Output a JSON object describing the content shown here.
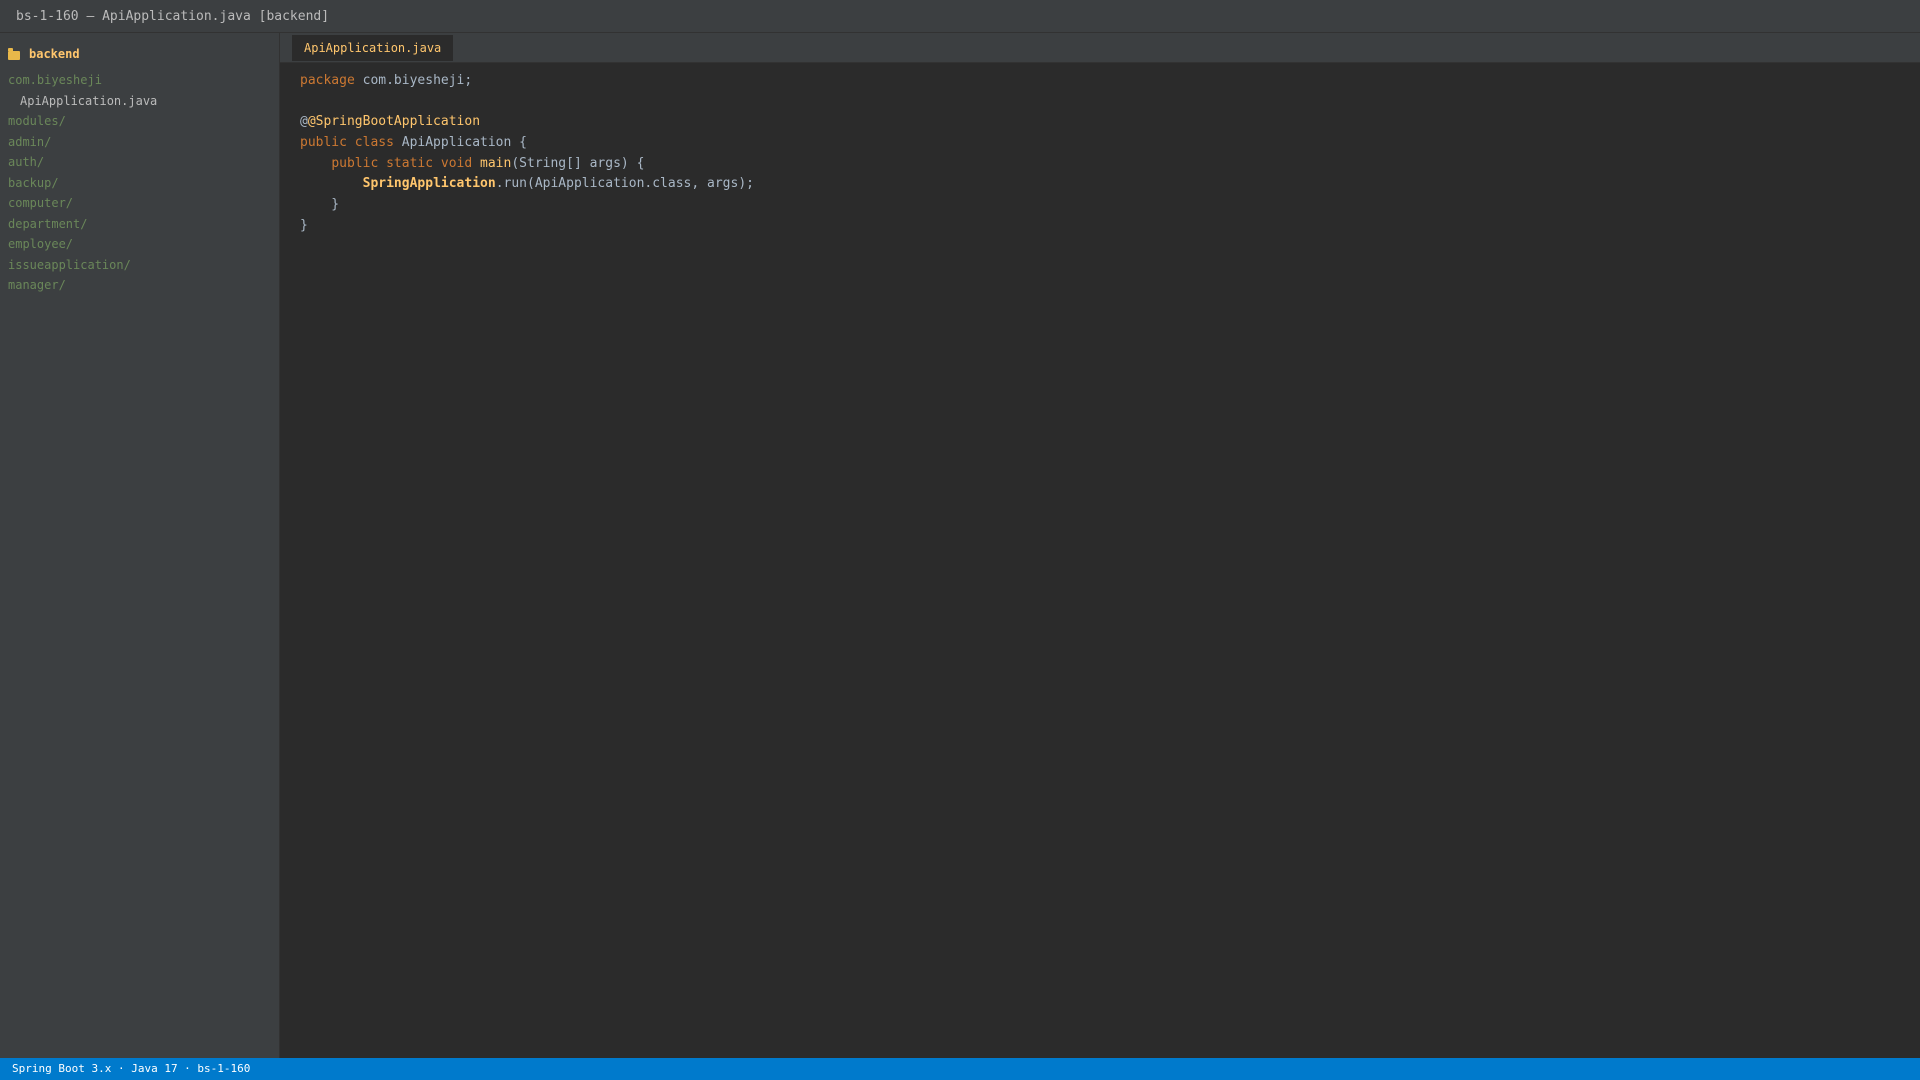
{
  "window": {
    "title": "bs-1-160 — ApiApplication.java [backend]"
  },
  "sidebar": {
    "root_label": "backend",
    "root_icon": "folder-icon",
    "items": [
      {
        "label": "com.biyesheji",
        "kind": "package"
      },
      {
        "label": "ApiApplication.java",
        "kind": "file"
      },
      {
        "label": "modules/",
        "kind": "folder"
      },
      {
        "label": "admin/",
        "kind": "folder"
      },
      {
        "label": "auth/",
        "kind": "folder"
      },
      {
        "label": "backup/",
        "kind": "folder"
      },
      {
        "label": "computer/",
        "kind": "folder"
      },
      {
        "label": "department/",
        "kind": "folder"
      },
      {
        "label": "employee/",
        "kind": "folder"
      },
      {
        "label": "issueapplication/",
        "kind": "folder"
      },
      {
        "label": "manager/",
        "kind": "folder"
      }
    ]
  },
  "editor": {
    "active_tab": "ApiApplication.java",
    "code": {
      "l1_kw": "package",
      "l1_rest": " com.biyesheji;",
      "l3_at": "@",
      "l3_ann": "@SpringBootApplication",
      "l4_kw": "public class",
      "l4_rest": " ApiApplication {",
      "l5_indent": "    ",
      "l5_kw": "public static void",
      "l5_sp": " ",
      "l5_fn": "main",
      "l5_rest": "(String[] args) {",
      "l6_indent": "        ",
      "l6_cls": "SpringApplication",
      "l6_rest": ".run(ApiApplication.class, args);",
      "l7": "    }",
      "l8": "}"
    }
  },
  "statusbar": {
    "text": "Spring Boot 3.x · Java 17 · bs-1-160"
  },
  "colors": {
    "background": "#2b2b2b",
    "panel": "#3c3f41",
    "keyword": "#cc7832",
    "annotation": "#ffc66d",
    "folder_text": "#6a8759",
    "status_bar": "#007acc"
  }
}
